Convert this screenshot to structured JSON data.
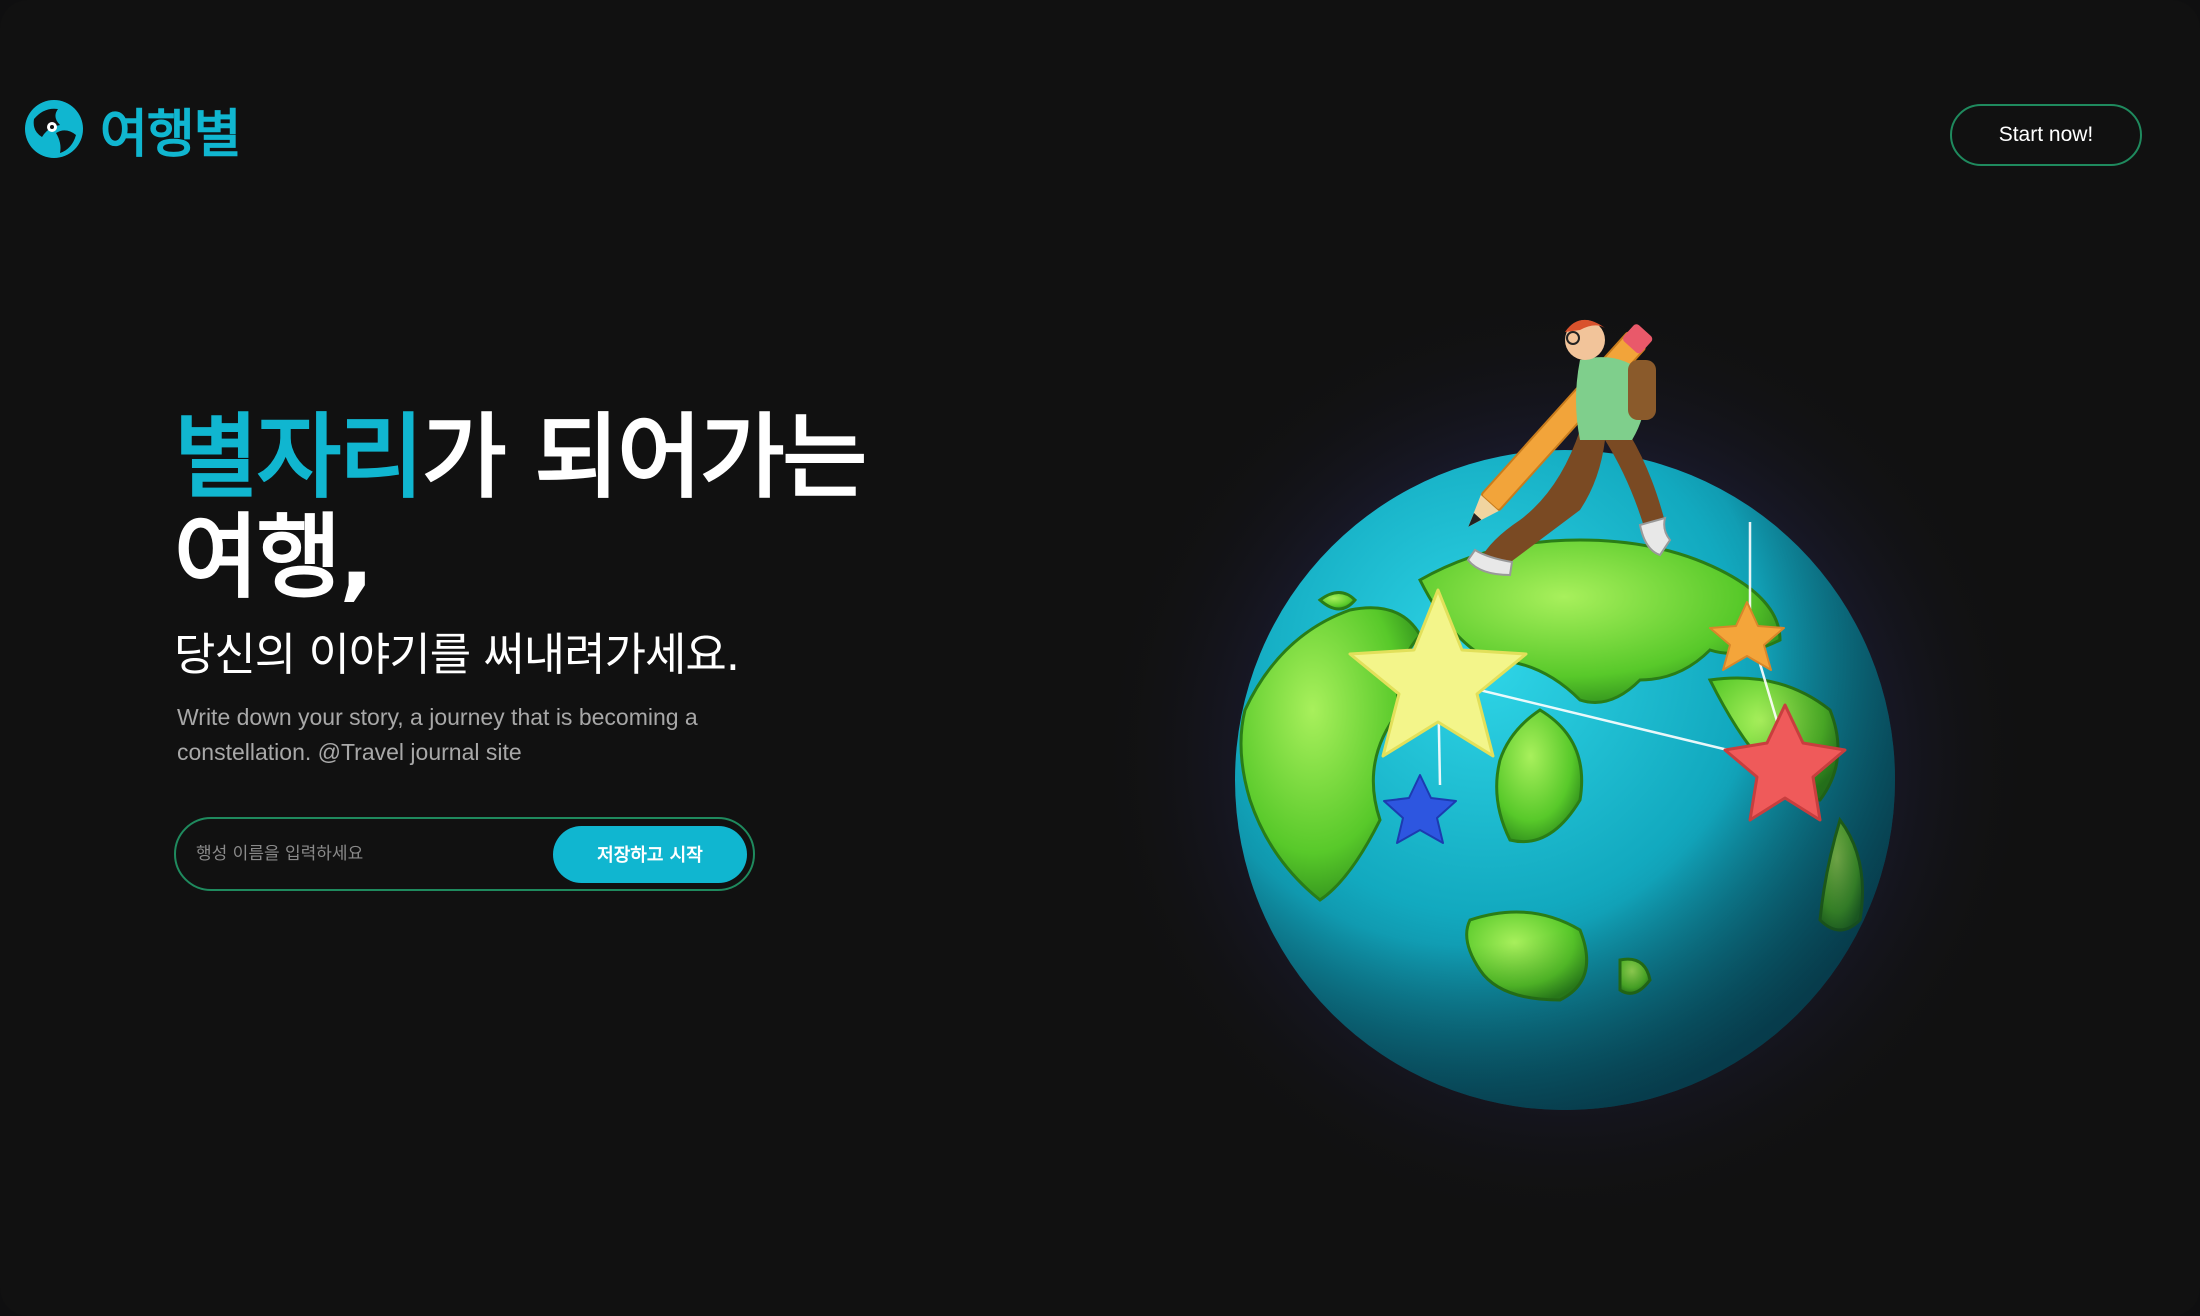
{
  "header": {
    "logo_text": "여행별",
    "logo_icon": "globe-pin-icon",
    "start_label": "Start now!"
  },
  "hero": {
    "title_accent": "별자리",
    "title_rest": "가 되어가는",
    "title_line2": "여행,",
    "subtitle": "당신의 이야기를 써내려가세요.",
    "description": "Write down your story, a journey that is becoming a constellation. @Travel journal site"
  },
  "form": {
    "placeholder": "행성 이름을 입력하세요",
    "value": "",
    "submit_label": "저장하고 시작"
  },
  "illustration": {
    "subject": "globe-with-stars-and-traveler-illustration"
  },
  "colors": {
    "background": "#111111",
    "accent": "#10b6d0",
    "border_green": "#1f8a5e",
    "text": "#ffffff",
    "muted": "#a8a8a8"
  }
}
